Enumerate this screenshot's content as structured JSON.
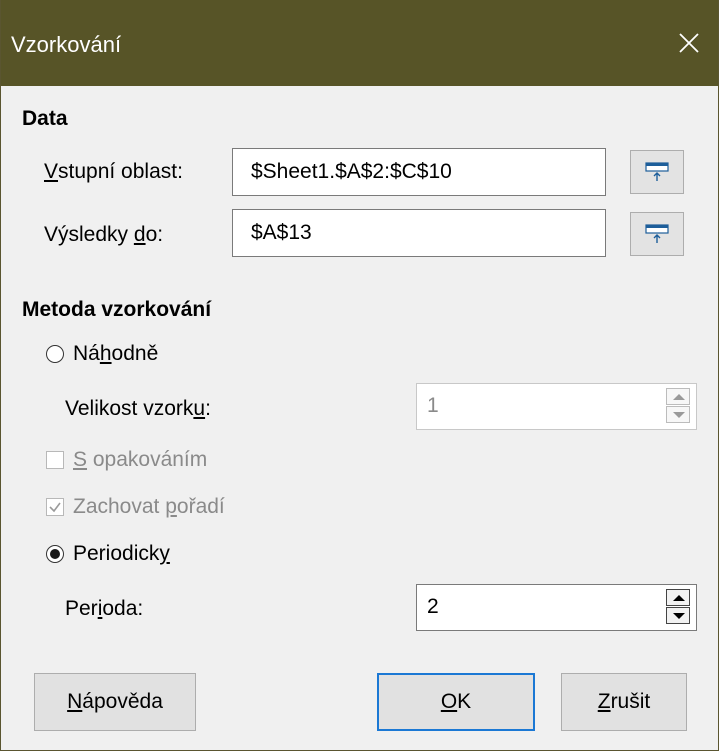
{
  "dialog": {
    "title": "Vzorkování",
    "close_icon": "close-icon"
  },
  "data_section": {
    "title": "Data",
    "input_range": {
      "label_mnemonic": "V",
      "label_rest": "stupní oblast:",
      "value": "$Sheet1.$A$2:$C$10"
    },
    "results_to": {
      "label_prefix": "Výsledky ",
      "label_mnemonic": "d",
      "label_rest": "o:",
      "value": "$A$13"
    },
    "shrink_icon": "shrink-range-icon"
  },
  "method_section": {
    "title": "Metoda vzorkování",
    "random": {
      "label_prefix": "Ná",
      "label_mnemonic": "h",
      "label_rest": "odně",
      "selected": false
    },
    "sample_size": {
      "label_prefix": "Velikost vzork",
      "label_mnemonic": "u",
      "label_rest": ":",
      "value": "1",
      "enabled": false
    },
    "with_replacement": {
      "label_mnemonic": "S",
      "label_rest": " opakováním",
      "checked": false,
      "enabled": false
    },
    "keep_order": {
      "label_prefix": "Zachovat ",
      "label_mnemonic": "p",
      "label_rest": "ořadí",
      "checked": true,
      "enabled": false
    },
    "periodic": {
      "label_prefix": "Periodick",
      "label_mnemonic": "y",
      "label_rest": "",
      "selected": true
    },
    "period": {
      "label_prefix": "Per",
      "label_mnemonic": "i",
      "label_rest": "oda:",
      "value": "2",
      "enabled": true
    }
  },
  "buttons": {
    "help": {
      "label_mnemonic": "N",
      "label_rest": "ápověda"
    },
    "ok": {
      "label_mnemonic": "O",
      "label_rest": "K"
    },
    "cancel": {
      "label_mnemonic": "Z",
      "label_rest": "rušit"
    }
  },
  "colors": {
    "titlebar": "#575427",
    "default_button_border": "#1b78d4",
    "disabled_text": "#8a8a8a"
  }
}
